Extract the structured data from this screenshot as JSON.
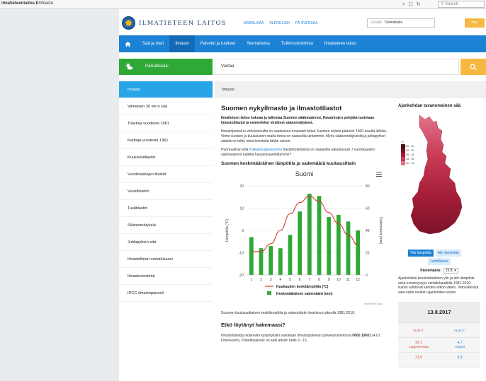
{
  "browser": {
    "url_prefix": "ilmatieteenlaitos.fi",
    "url_path": "/ilmasto",
    "search_placeholder": "Search"
  },
  "header": {
    "logo_text": "ILMATIETEEN LAITOS",
    "links": [
      "MOBIILISÄÄ",
      "IN ENGLISH",
      "PÅ SVENSKA"
    ],
    "search_engine_label": "Google",
    "search_value": "Täsmähaku",
    "search_button": "Hae"
  },
  "nav": {
    "items": [
      "Sää ja meri",
      "Ilmasto",
      "Palvelut ja tuotteet",
      "Teematietoa",
      "Tutkimustoiminta",
      "Ilmatieteen laitos"
    ],
    "active_index": 1
  },
  "weather_bar": {
    "label": "Paikallissää:",
    "location_value": "Vantaa"
  },
  "sidebar": {
    "items": [
      "Ilmasto",
      "Viimeisen 30 vrk:n sää",
      "Tilastoja vuodesta 1961",
      "Karttoja vuodesta 1961",
      "Kuukausitilastot",
      "Vuodenaikojen tilastot",
      "Vuositilastot",
      "Tuulitilastot",
      "Säänennätyksiä",
      "Juhlapyhien sää",
      "Ilmastollinen vertailukausi",
      "Ilmastoviestintä",
      "IPCC-ilmastopaneeli"
    ],
    "active_index": 0
  },
  "content_bar": {
    "breadcrumb": "Ilmasto"
  },
  "main": {
    "title": "Suomen nykyilmasto ja ilmastotilastot",
    "lead": "Ilmatieteen laitos kokoaa ja tallentaa Suomen säähavainnot. Havaintojen pohjalta tuotetaan ilmastotilastot ja esimerkiksi viralliset säänennätykset.",
    "p1": "Ilmastopalvelun verkkosivuilta on saatavissa runsaasti tietoa Suomen säästä pääosin 1960-luvulta lähtien. Viime vuosien ja kuukausien osalta tietoa on saatavilla tarkemmin. Myös säänennätyksistä ja juhlapyhien säästä on tehty omia koosteita tähän osioon.",
    "p2_before": "Huomaathan että ",
    "p2_link": "Paikallissääsivumme",
    "p2_after": " havaintotiedoista on saatavilla takautuvasti 7 vuorokauden säähavainnot kaikilta havaintoasemiltamme?",
    "chart_heading": "Suomen keskimääräinen lämpötila ja sademäärä kuukausittain",
    "chart_caption": "Suomen kuukausittainen keskilämpötila ja sademäärän keskiarvo jaksolla 1981-2010.",
    "not_found_heading": "Etkö löytänyt hakemaasi?",
    "p3_before": "Ilmastotilastoja koskeviin kysymyksiin vastataan ilmastopalvelun palvelunumerossa ",
    "p3_phone": "0600 10601",
    "p3_after": " (4,01 €/min+pvm). Puhelinpalvelu on auki arkisin kello 9 - 15."
  },
  "chart_data": {
    "type": "bar",
    "title": "Suomi",
    "categories": [
      "1",
      "2",
      "3",
      "4",
      "5",
      "6",
      "7",
      "8",
      "9",
      "10",
      "11",
      "12"
    ],
    "y_left_label": "Lämpötila (°C)",
    "y_right_label": "Sademäärä (mm)",
    "y_left_lim": [
      -20,
      20
    ],
    "y_left_ticks": [
      20,
      10,
      0,
      -10,
      -20
    ],
    "y_right_lim": [
      0,
      80
    ],
    "y_right_ticks": [
      80,
      60,
      40,
      20,
      0
    ],
    "series": [
      {
        "name": "Keskimääräinen sademäärä (mm)",
        "type": "bar",
        "axis": "right",
        "color": "#2fa836",
        "values": [
          34,
          24,
          26,
          24,
          36,
          57,
          73,
          71,
          52,
          54,
          48,
          40
        ]
      },
      {
        "name": "Kuukauden keskilämpötila (°C)",
        "type": "line",
        "axis": "left",
        "color": "#d33a2f",
        "values": [
          -9.5,
          -9.5,
          -6,
          0,
          7.5,
          12.5,
          15.5,
          13,
          8,
          3,
          -2,
          -6.5
        ]
      }
    ],
    "credit": "Ilmatieteen laitos",
    "legend_position": "bottom"
  },
  "right_panel": {
    "heading": "Ajankohdan tavanomainen sää",
    "map_legend_title": "°C",
    "map_legend": [
      {
        "label": "20 - 22",
        "color": "#4b0b1c"
      },
      {
        "label": "18 - 20",
        "color": "#7a1329"
      },
      {
        "label": "16 - 18",
        "color": "#a31d38"
      },
      {
        "label": "14 - 16",
        "color": "#c93a55"
      },
      {
        "label": "12 - 14",
        "color": "#e0738a"
      }
    ],
    "buttons": [
      "Ylin lämpötila",
      "Alin lämpötila",
      "Lumitilanne"
    ],
    "active_button": 0,
    "date_label": "Päivämäärä:",
    "date_value": "15.8.",
    "note": "Ajankohdan keskimääräinen ylin ja alin lämpötila sekä lumensyvyys vertailukaudella 1981-2010. Kartat vaihtuvat kahden viikon välein. Vetovalikosta saat esille muiden ajankohtien kartat.",
    "obs_date": "13.8.2017",
    "obs_head": [
      "YLIN C°",
      "ALIN C°"
    ],
    "obs_rows": [
      {
        "max": "22,1",
        "max_place": "Lappeenranta",
        "min": "4,7",
        "min_place": "Utsjoki"
      },
      {
        "max": "21,9",
        "max_place": "",
        "min": "5,9",
        "min_place": ""
      }
    ]
  }
}
